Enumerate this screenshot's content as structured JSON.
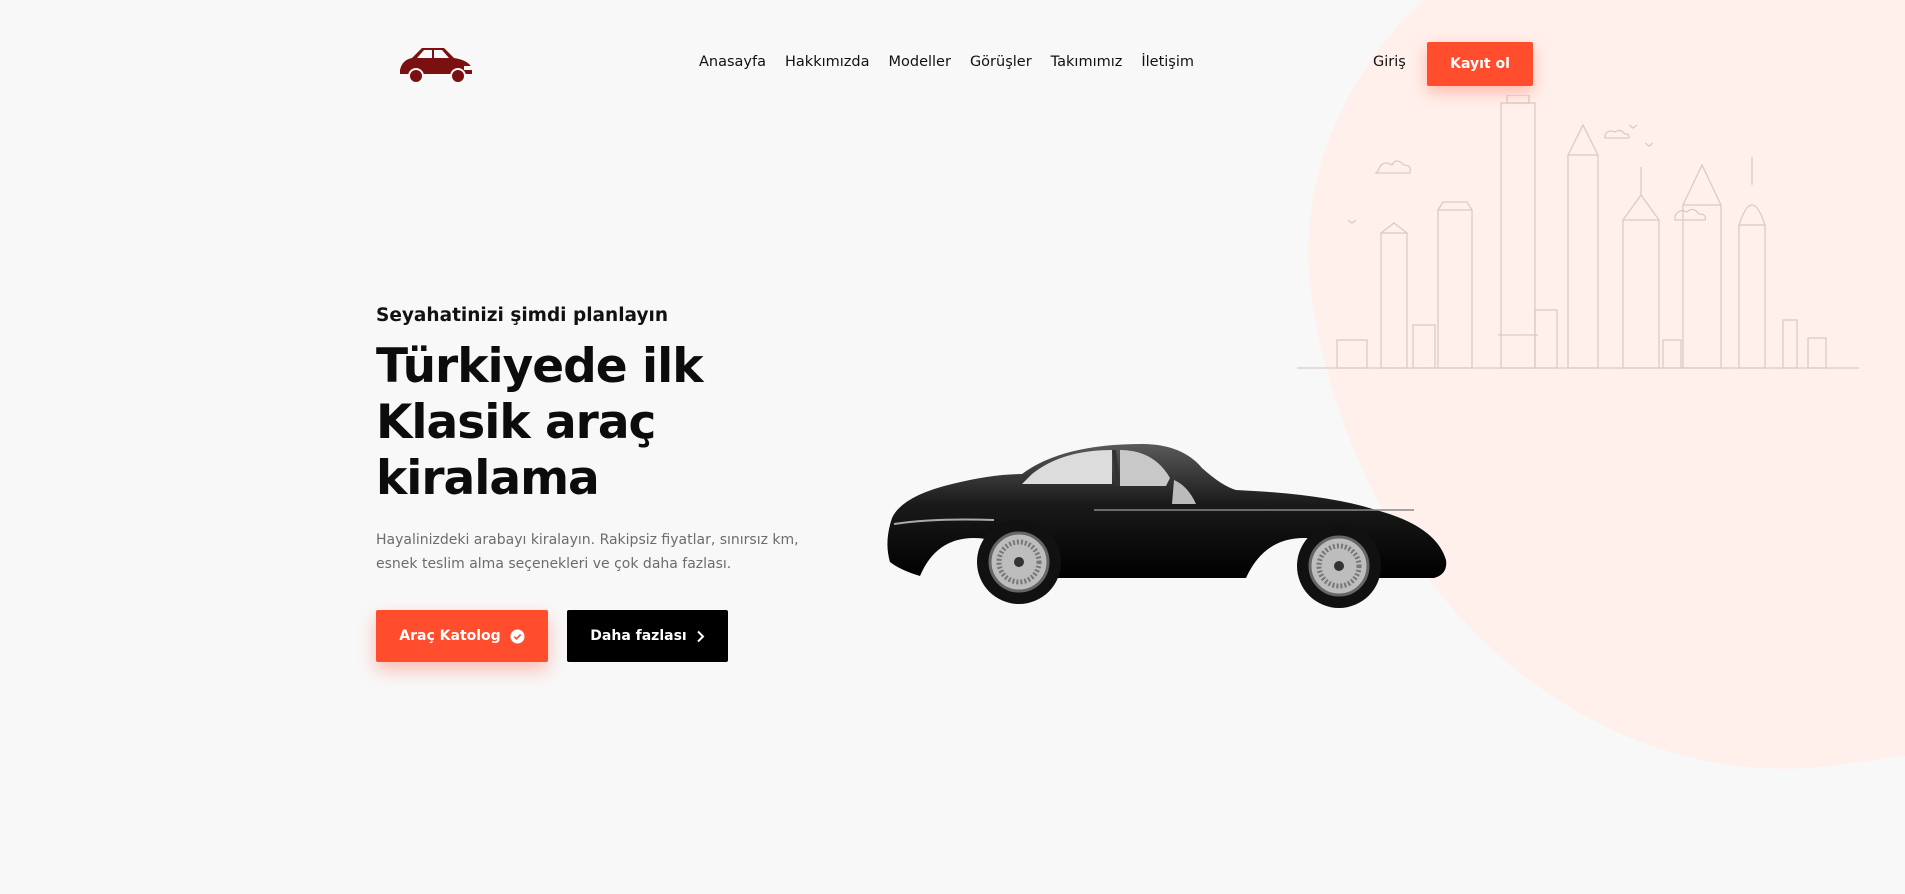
{
  "header": {
    "logo_icon": "classic-car-logo",
    "nav": [
      "Anasayfa",
      "Hakkımızda",
      "Modeller",
      "Görüşler",
      "Takımımız",
      "İletişim"
    ],
    "login_label": "Giriş",
    "signup_label": "Kayıt ol"
  },
  "hero": {
    "eyebrow": "Seyahatinizi şimdi planlayın",
    "title_lines": [
      "Türkiyede ilk",
      "Klasik araç",
      "kiralama"
    ],
    "description": "Hayalinizdeki arabayı kiralayın. Rakipsiz fiyatlar, sınırsız km, esnek teslim alma seçenekleri ve çok daha fazlası.",
    "primary_button": "Araç Katolog",
    "primary_button_icon": "check-circle-icon",
    "secondary_button": "Daha fazlası",
    "secondary_button_icon": "chevron-right-icon"
  },
  "colors": {
    "accent": "#ff4d2d",
    "blob": "#fff0ec",
    "logo": "#7a1010",
    "skyline": "#d8ccc8"
  }
}
